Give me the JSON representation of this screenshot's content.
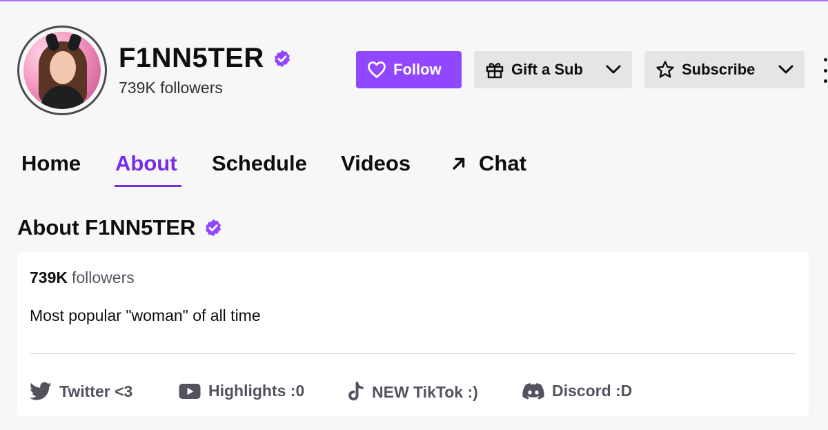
{
  "channel": {
    "name": "F1NN5TER",
    "followers": "739K followers"
  },
  "actions": {
    "follow_label": "Follow",
    "gift_label": "Gift a Sub",
    "subscribe_label": "Subscribe"
  },
  "tabs": [
    {
      "label": "Home"
    },
    {
      "label": "About"
    },
    {
      "label": "Schedule"
    },
    {
      "label": "Videos"
    },
    {
      "label": "Chat"
    }
  ],
  "active_tab": "About",
  "about": {
    "heading": "About F1NN5TER",
    "followers_count": "739K",
    "followers_label": "followers",
    "bio": "Most popular \"woman\" of all time"
  },
  "social_links": [
    {
      "label": "Twitter <3",
      "icon": "twitter-icon"
    },
    {
      "label": "Highlights :0",
      "icon": "youtube-icon"
    },
    {
      "label": "NEW TikTok :)",
      "icon": "tiktok-icon"
    },
    {
      "label": "Discord :D",
      "icon": "discord-icon"
    }
  ],
  "colors": {
    "accent": "#9147ff",
    "active_tab": "#772ce8",
    "background": "#f7f7f8",
    "secondary_button": "#e5e5e8"
  }
}
